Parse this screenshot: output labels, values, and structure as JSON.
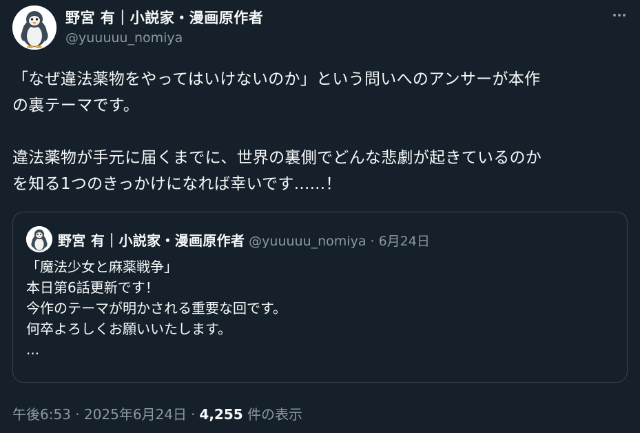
{
  "author": {
    "display_name": "野宮 有｜小説家・漫画原作者",
    "handle": "@yuuuuu_nomiya"
  },
  "tweet": {
    "lines": [
      "「なぜ違法薬物をやってはいけないのか」という問いへのアンサーが本作",
      "の裏テーマです。",
      "",
      "違法薬物が手元に届くまでに、世界の裏側でどんな悲劇が起きているのか",
      "を知る1つのきっかけになれば幸いです......！"
    ]
  },
  "quoted": {
    "display_name": "野宮 有｜小説家・漫画原作者",
    "handle_and_date": "@yuuuuu_nomiya · 6月24日",
    "lines": [
      "「魔法少女と麻薬戦争」",
      "本日第6話更新です！",
      "今作のテーマが明かされる重要な回です。",
      "何卒よろしくお願いいたします。",
      "..."
    ]
  },
  "footer": {
    "timestamp": "午後6:53 · 2025年6月24日",
    "separator": "·",
    "views_count": "4,255",
    "views_label": "件の表示"
  },
  "icons": {
    "avatar": "penguin-avatar-icon",
    "more": "more-options-icon"
  },
  "colors": {
    "background": "#15202b",
    "text_primary": "#f7f9f9",
    "text_secondary": "#8b98a5",
    "border": "#38444d"
  }
}
